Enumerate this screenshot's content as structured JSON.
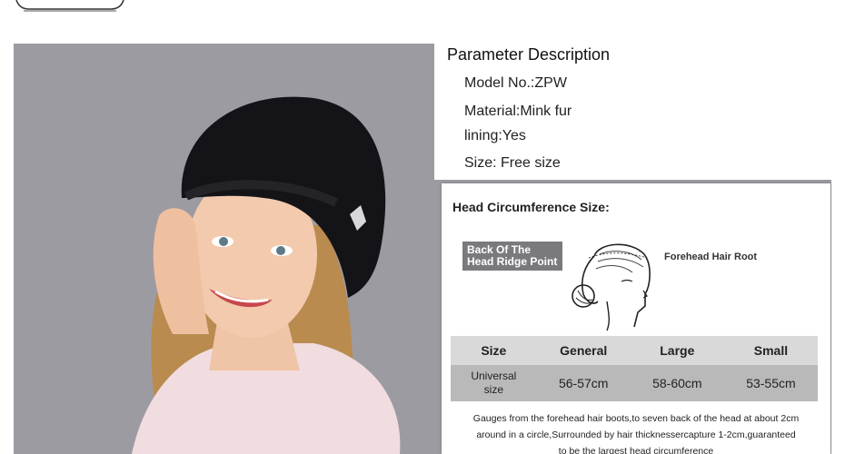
{
  "parameters": {
    "title": "Parameter Description",
    "model": "Model No.:ZPW",
    "material": "Material:Mink fur",
    "lining": "lining:Yes",
    "size": "Size: Free size"
  },
  "head_card": {
    "title": "Head Circumference Size:",
    "back_label_line1": "Back Of The",
    "back_label_line2": "Head Ridge Point",
    "forehead_label": "Forehead Hair Root",
    "table": {
      "headers": [
        "Size",
        "General",
        "Large",
        "Small"
      ],
      "row_label_line1": "Universal",
      "row_label_line2": "size",
      "values": [
        "56-57cm",
        "58-60cm",
        "53-55cm"
      ]
    },
    "note_line1": "Gauges from the forehead hair boots,to seven back of the head at about 2cm",
    "note_line2": "around in a circle,Surrounded by hair thicknessercapture 1-2cm,guaranteed",
    "note_line3": "to be the largest head circumference"
  },
  "colors": {
    "photo_background": "#9d9ba2",
    "hat": "#141418",
    "table_header": "#d9d9d9",
    "table_row": "#b9b9b9",
    "label_box": "#7a797e"
  }
}
